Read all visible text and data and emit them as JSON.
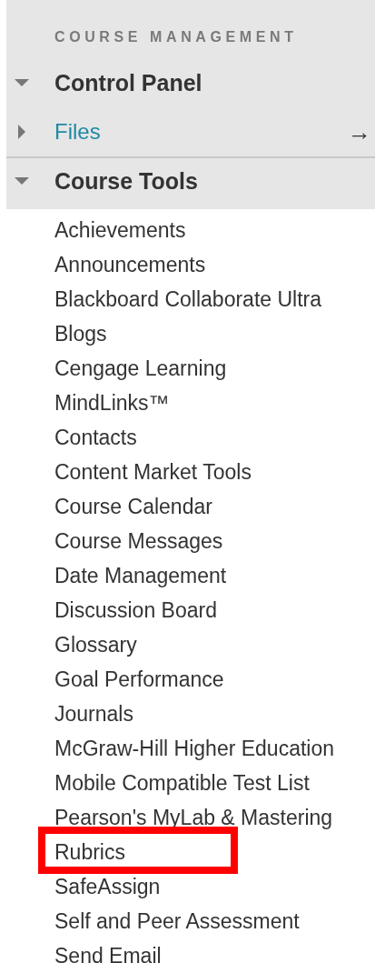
{
  "section_title": "COURSE MANAGEMENT",
  "panels": [
    {
      "label": "Control Panel",
      "expanded": true,
      "kind": "header"
    },
    {
      "label": "Files",
      "expanded": false,
      "kind": "link",
      "arrow": "→"
    },
    {
      "label": "Course Tools",
      "expanded": true,
      "kind": "header"
    }
  ],
  "tools": [
    {
      "label": "Achievements",
      "highlighted": false
    },
    {
      "label": "Announcements",
      "highlighted": false
    },
    {
      "label": "Blackboard Collaborate Ultra",
      "highlighted": false
    },
    {
      "label": "Blogs",
      "highlighted": false
    },
    {
      "label": "Cengage Learning\nMindLinks™",
      "highlighted": false
    },
    {
      "label": "Contacts",
      "highlighted": false
    },
    {
      "label": "Content Market Tools",
      "highlighted": false
    },
    {
      "label": "Course Calendar",
      "highlighted": false
    },
    {
      "label": "Course Messages",
      "highlighted": false
    },
    {
      "label": "Date Management",
      "highlighted": false
    },
    {
      "label": "Discussion Board",
      "highlighted": false
    },
    {
      "label": "Glossary",
      "highlighted": false
    },
    {
      "label": "Goal Performance",
      "highlighted": false
    },
    {
      "label": "Journals",
      "highlighted": false
    },
    {
      "label": "McGraw-Hill Higher Education",
      "highlighted": false
    },
    {
      "label": "Mobile Compatible Test List",
      "highlighted": false
    },
    {
      "label": "Pearson's MyLab & Mastering",
      "highlighted": false
    },
    {
      "label": "Rubrics",
      "highlighted": true
    },
    {
      "label": "SafeAssign",
      "highlighted": false
    },
    {
      "label": "Self and Peer Assessment",
      "highlighted": false
    },
    {
      "label": "Send Email",
      "highlighted": false
    }
  ]
}
